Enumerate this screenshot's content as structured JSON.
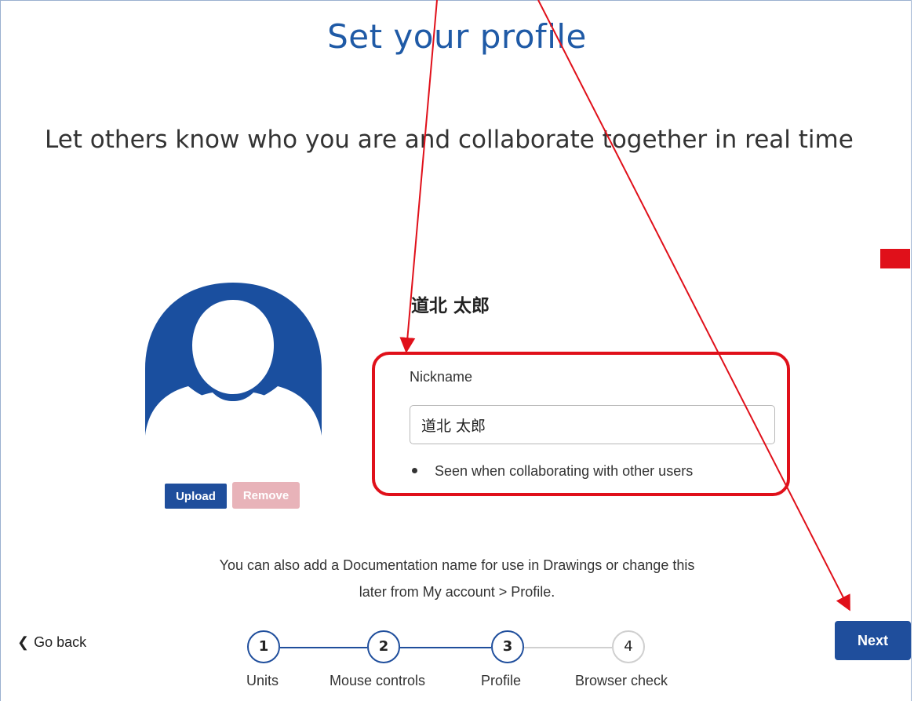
{
  "page": {
    "title": "Set your profile",
    "subtitle": "Let others know who you are and collaborate together in real time"
  },
  "profile": {
    "display_name": "道北 太郎",
    "upload_label": "Upload",
    "remove_label": "Remove",
    "nickname": {
      "label": "Nickname",
      "value": "道北 太郎",
      "hint": "Seen when collaborating with other users"
    }
  },
  "info": {
    "line1": "You can also add a Documentation name for use in Drawings or change this",
    "line2": "later from My account > Profile."
  },
  "nav": {
    "go_back_label": "Go back",
    "next_label": "Next"
  },
  "steps": [
    {
      "number": "1",
      "label": "Units",
      "state": "complete"
    },
    {
      "number": "2",
      "label": "Mouse controls",
      "state": "complete"
    },
    {
      "number": "3",
      "label": "Profile",
      "state": "current"
    },
    {
      "number": "4",
      "label": "Browser check",
      "state": "pending"
    }
  ],
  "colors": {
    "accent": "#1f4e9c",
    "title": "#1f5aa6",
    "annotation": "#e0101a",
    "remove_button": "#e8b3b9",
    "inactive_step": "#cfcfcf"
  },
  "icons": {
    "go_back": "chevron-left-icon",
    "avatar": "user-avatar-icon"
  }
}
